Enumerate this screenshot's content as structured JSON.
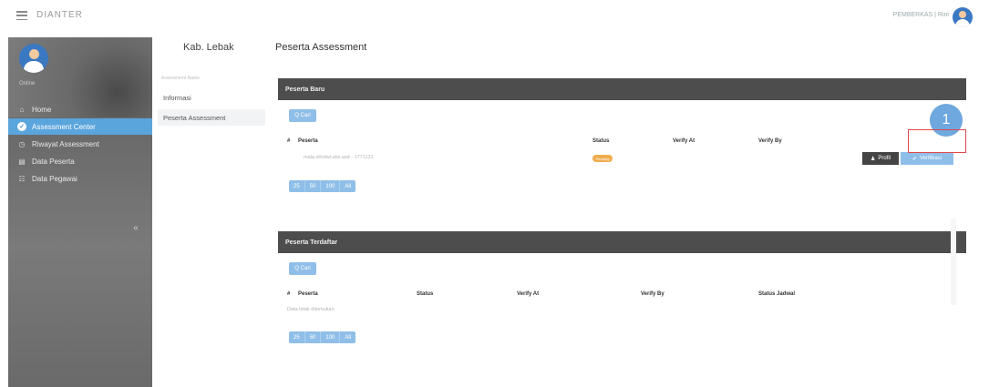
{
  "topbar": {
    "brand": "DIANTER",
    "user_name": "PEMBERKAS | Rini"
  },
  "sidebar": {
    "online_label": "Online",
    "items": [
      {
        "label": "Home",
        "icon": "home-icon",
        "glyph": "⌂",
        "active": false
      },
      {
        "label": "Assessment Center",
        "icon": "check-icon",
        "glyph": "✔",
        "active": true
      },
      {
        "label": "Riwayat Assessment",
        "icon": "history-icon",
        "glyph": "◷",
        "active": false
      },
      {
        "label": "Data Peserta",
        "icon": "users-icon",
        "glyph": "▤",
        "active": false
      },
      {
        "label": "Data Pegawai",
        "icon": "employees-icon",
        "glyph": "☷",
        "active": false
      }
    ],
    "collapse_label": "«"
  },
  "subnav": {
    "title": "Kab. Lebak",
    "hint": "Assessment Name",
    "items": [
      "Informasi",
      "Peserta Assessment"
    ]
  },
  "page_title": "Peserta Assessment",
  "peserta_baru": {
    "header": "Peserta Baru",
    "search_label": "Q Cari",
    "columns": {
      "no": "#",
      "peserta": "Peserta",
      "status": "Status",
      "verify_at": "Verify At",
      "verify_by": "Verify By"
    },
    "row": {
      "text": "mala.ziholwi.ubs.asd - 1771131",
      "status": "Pending",
      "profil_label": "Profil",
      "verify_label": "Verifikasi"
    },
    "pager": [
      "25",
      "50",
      "100",
      "All"
    ]
  },
  "peserta_terdaftar": {
    "header": "Peserta Terdaftar",
    "search_label": "Q Cari",
    "columns": {
      "no": "#",
      "peserta": "Peserta",
      "status": "Status",
      "verify_at": "Verify At",
      "verify_by": "Verify By",
      "status_jadwal": "Status Jadwal"
    },
    "empty_text": "Data tidak ditemukan",
    "pager": [
      "25",
      "50",
      "100",
      "All"
    ]
  },
  "marker": {
    "number": "1"
  },
  "colors": {
    "accent": "#5aa5dc",
    "sidebar": "#6b6b6b",
    "panel_header": "#4d4d4d",
    "marker_box": "#e2474a"
  }
}
